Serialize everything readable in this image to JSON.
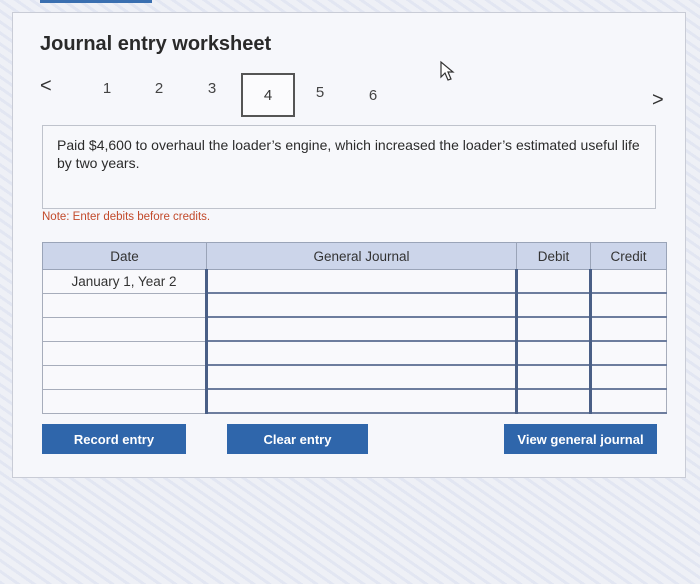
{
  "header": {
    "title": "Journal entry worksheet"
  },
  "pager": {
    "prev_icon": "chevron-left-icon",
    "prev_symbol": "<",
    "next_icon": "chevron-right-icon",
    "next_symbol": ">",
    "pages": [
      "1",
      "2",
      "3",
      "4",
      "5",
      "6"
    ],
    "active_page": "4"
  },
  "prompt": {
    "text": "Paid $4,600 to overhaul the loader’s engine, which increased the loader’s estimated useful life by two years."
  },
  "note": "Note: Enter debits before credits.",
  "journal": {
    "columns": [
      "Date",
      "General Journal",
      "Debit",
      "Credit"
    ],
    "rows": [
      [
        "January 1, Year 2",
        "",
        "",
        ""
      ],
      [
        "",
        "",
        "",
        ""
      ],
      [
        "",
        "",
        "",
        ""
      ],
      [
        "",
        "",
        "",
        ""
      ],
      [
        "",
        "",
        "",
        ""
      ],
      [
        "",
        "",
        "",
        ""
      ]
    ]
  },
  "buttons": {
    "record": "Record entry",
    "clear": "Clear entry",
    "view": "View general journal"
  },
  "colors": {
    "accent": "#2f66ab",
    "note": "#c24a2b",
    "header_bg": "#ccd5ea"
  }
}
